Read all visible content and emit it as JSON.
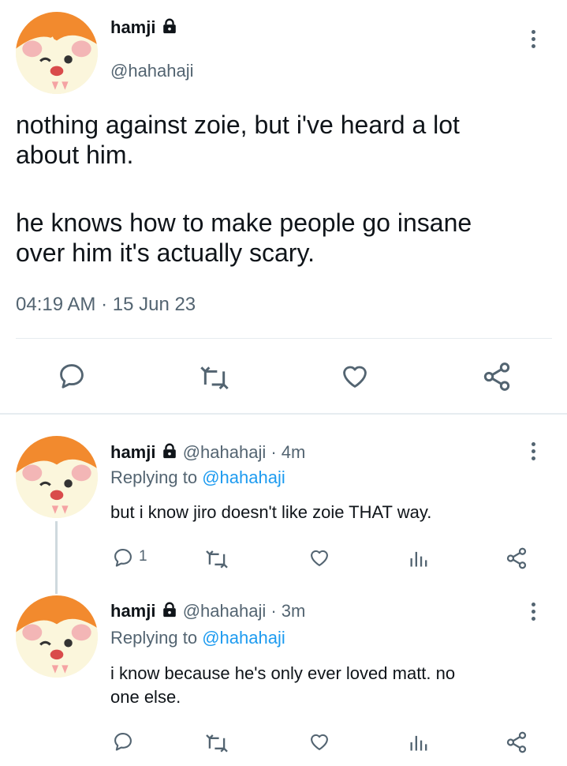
{
  "main_tweet": {
    "display_name": "hamji",
    "handle": "@hahahaji",
    "text_paragraph_1_line_1": "nothing against zoie, but i've heard a lot",
    "text_paragraph_1_line_2": "about him.",
    "text_paragraph_2_line_1": "he knows how to make people go insane",
    "text_paragraph_2_line_2": "over him it's actually scary.",
    "timestamp": "04:19 AM · 15 Jun 23"
  },
  "replies": [
    {
      "display_name": "hamji",
      "handle_time": "@hahahaji · 4m",
      "replying_prefix": "Replying to",
      "replying_to": "@hahahaji",
      "text_line_1": "but i know jiro doesn't like zoie THAT way.",
      "text_line_2": "",
      "reply_count": "1"
    },
    {
      "display_name": "hamji",
      "handle_time": "@hahahaji · 3m",
      "replying_prefix": "Replying to",
      "replying_to": "@hahahaji",
      "text_line_1": "i know because he's only ever loved matt. no",
      "text_line_2": "one else.",
      "reply_count": ""
    }
  ],
  "icons": [
    "lock-icon",
    "more-icon",
    "reply-icon",
    "retweet-icon",
    "like-icon",
    "views-icon",
    "share-icon"
  ],
  "colors": {
    "text": "#0f1419",
    "muted": "#536471",
    "link": "#1d9bf0",
    "divider": "#e6ecf0",
    "avatar_orange": "#f28a2e"
  }
}
